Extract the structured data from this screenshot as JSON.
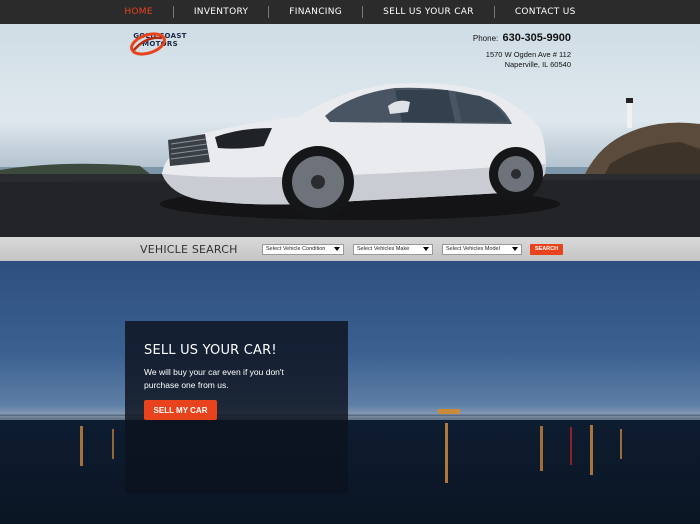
{
  "nav": {
    "items": [
      {
        "label": "HOME",
        "active": true
      },
      {
        "label": "INVENTORY",
        "active": false
      },
      {
        "label": "FINANCING",
        "active": false
      },
      {
        "label": "SELL US YOUR CAR",
        "active": false
      },
      {
        "label": "CONTACT US",
        "active": false
      }
    ]
  },
  "brand": {
    "name_line1": "GOLD COAST",
    "name_line2": "MOTORS",
    "logo_icon": "swoosh-logo-icon",
    "accent_color": "#e8431c"
  },
  "contact": {
    "phone_label": "Phone:",
    "phone_number": "630-305-9900",
    "address_line1": "1570 W Ogden Ave # 112",
    "address_line2": "Naperville, IL 60540"
  },
  "search": {
    "title": "VEHICLE SEARCH",
    "condition_select": "Select Vehicle Condition",
    "make_select": "Select Vehicles Make",
    "model_select": "Select Vehicles Model",
    "button_label": "SEARCH"
  },
  "promo": {
    "title": "SELL US YOUR CAR!",
    "text": "We will buy your car even if you don't purchase one from us.",
    "button_label": "SELL MY CAR"
  }
}
